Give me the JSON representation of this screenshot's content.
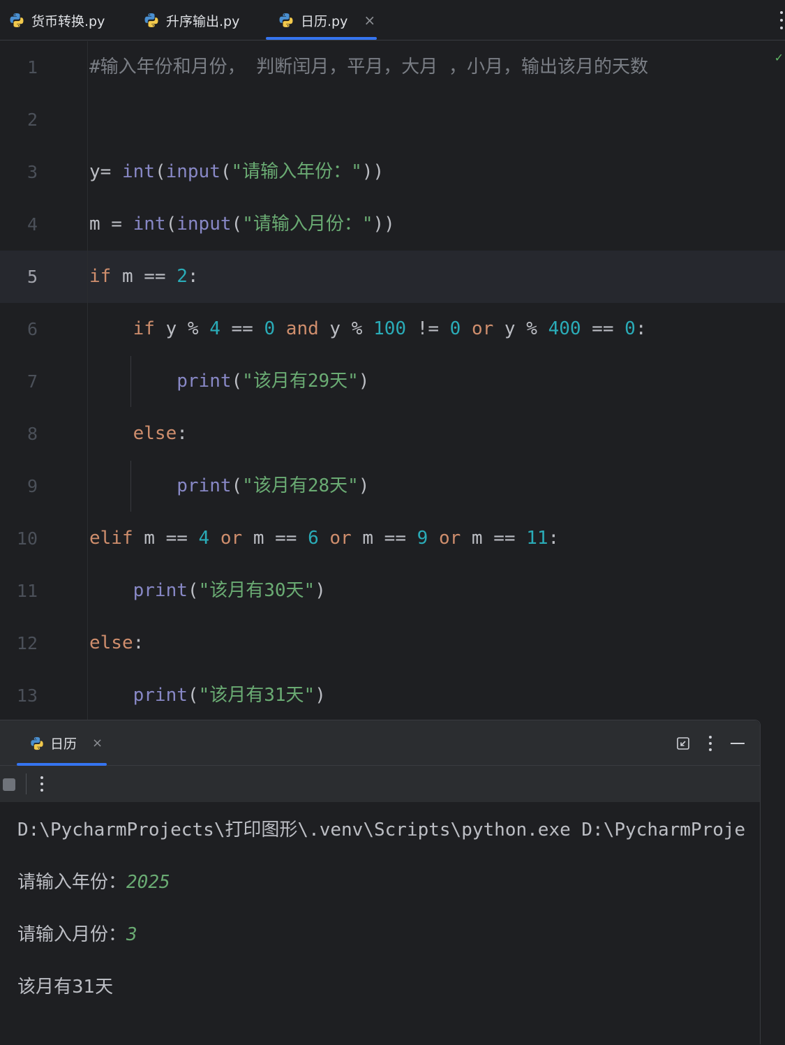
{
  "editor_tabs": [
    {
      "label": "货币转换.py",
      "active": false
    },
    {
      "label": "升序输出.py",
      "active": false
    },
    {
      "label": "日历.py",
      "active": true,
      "close": "×"
    }
  ],
  "code_lines": [
    {
      "num": "1"
    },
    {
      "num": "2"
    },
    {
      "num": "3"
    },
    {
      "num": "4"
    },
    {
      "num": "5"
    },
    {
      "num": "6"
    },
    {
      "num": "7"
    },
    {
      "num": "8"
    },
    {
      "num": "9"
    },
    {
      "num": "10"
    },
    {
      "num": "11"
    },
    {
      "num": "12"
    },
    {
      "num": "13"
    }
  ],
  "tokens": {
    "l1_comment": "#输入年份和月份， 判断闰月，平月，大月 ，小月，输出该月的天数",
    "l3": {
      "var": "y= ",
      "int": "int",
      "p1": "(",
      "input": "input",
      "p2": "(",
      "str": "\"请输入年份：\"",
      "close": "))"
    },
    "l4": {
      "var": "m = ",
      "int": "int",
      "p1": "(",
      "input": "input",
      "p2": "(",
      "str": "\"请输入月份：\"",
      "close": "))"
    },
    "l5": {
      "if": "if",
      "rest": " m == ",
      "n": "2",
      "colon": ":"
    },
    "l6": {
      "indent": "    ",
      "if": "if",
      "a": " y % ",
      "n4": "4",
      "b": " == ",
      "n0a": "0",
      "and": " and",
      "c": " y % ",
      "n100": "100",
      "d": " != ",
      "n0b": "0",
      "or": " or",
      "e": " y % ",
      "n400": "400",
      "f": " == ",
      "n0c": "0",
      "colon": ":"
    },
    "l7": {
      "indent": "        ",
      "print": "print",
      "p": "(",
      "str": "\"该月有29天\"",
      "close": ")"
    },
    "l8": {
      "indent": "    ",
      "else": "else",
      "colon": ":"
    },
    "l9": {
      "indent": "        ",
      "print": "print",
      "p": "(",
      "str": "\"该月有28天\"",
      "close": ")"
    },
    "l10": {
      "elif": "elif",
      "a": " m == ",
      "n4": "4",
      "or1": " or",
      "b": " m == ",
      "n6": "6",
      "or2": " or",
      "c": " m == ",
      "n9": "9",
      "or3": " or",
      "d": " m == ",
      "n11": "11",
      "colon": ":"
    },
    "l11": {
      "indent": "    ",
      "print": "print",
      "p": "(",
      "str": "\"该月有30天\"",
      "close": ")"
    },
    "l12": {
      "else": "else",
      "colon": ":"
    },
    "l13": {
      "indent": "    ",
      "print": "print",
      "p": "(",
      "str": "\"该月有31天\"",
      "close": ")"
    }
  },
  "run_panel": {
    "tab_label": "日历",
    "tab_close": "×",
    "console": {
      "command": "D:\\PycharmProjects\\打印图形\\.venv\\Scripts\\python.exe D:\\PycharmProje",
      "prompt_year": "请输入年份：",
      "input_year": "2025",
      "prompt_month": "请输入月份：",
      "input_month": "3",
      "result": "该月有31天"
    }
  },
  "colors": {
    "background": "#1e1f22",
    "keyword": "#cf8e6d",
    "builtin": "#8888c6",
    "string": "#6aab73",
    "number": "#2aacb8",
    "comment": "#7a7e85",
    "accent": "#3574f0"
  },
  "icons": [
    "python-file-icon",
    "close-icon",
    "more-vertical-icon",
    "restore-layout-icon",
    "minimize-icon",
    "stop-icon"
  ]
}
